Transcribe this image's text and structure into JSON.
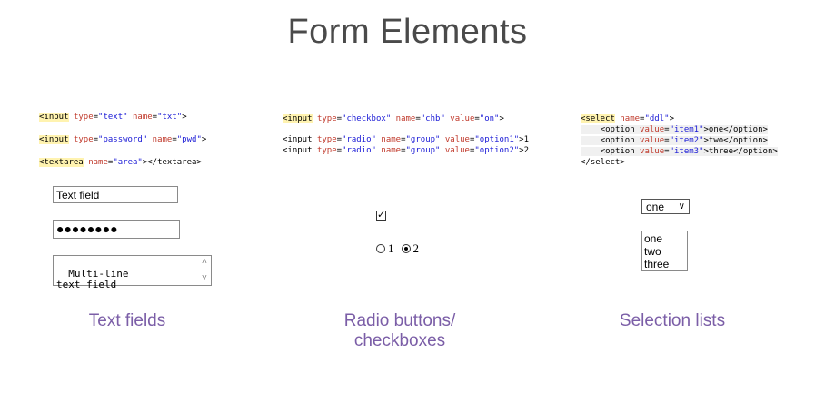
{
  "title": "Form Elements",
  "text_fields": {
    "code_lines": [
      "<input type=\"text\" name=\"txt\">",
      "<input type=\"password\" name=\"pwd\">",
      "<textarea name=\"area\"></textarea>"
    ],
    "text_value": "Text field",
    "password_mask": "●●●●●●●●",
    "textarea_value": "Multi-line\ntext field",
    "caption": "Text fields"
  },
  "radio_checkbox": {
    "code_lines": [
      "<input type=\"checkbox\" name=\"chb\" value=\"on\">",
      "<input type=\"radio\" name=\"group\" value=\"option1\">1",
      "<input type=\"radio\" name=\"group\" value=\"option2\">2"
    ],
    "checkbox_checked": true,
    "radios": [
      {
        "label": "1",
        "checked": false
      },
      {
        "label": "2",
        "checked": true
      }
    ],
    "caption_line1": "Radio buttons/",
    "caption_line2": "checkboxes"
  },
  "selection": {
    "code_lines": [
      "<select name=\"ddl\">",
      "    <option value=\"item1\">one</option>",
      "    <option value=\"item2\">two</option>",
      "    <option value=\"item3\">three</option>",
      "</select>"
    ],
    "dropdown_value": "one",
    "list_options": [
      "one",
      "two",
      "three"
    ],
    "caption": "Selection lists"
  }
}
